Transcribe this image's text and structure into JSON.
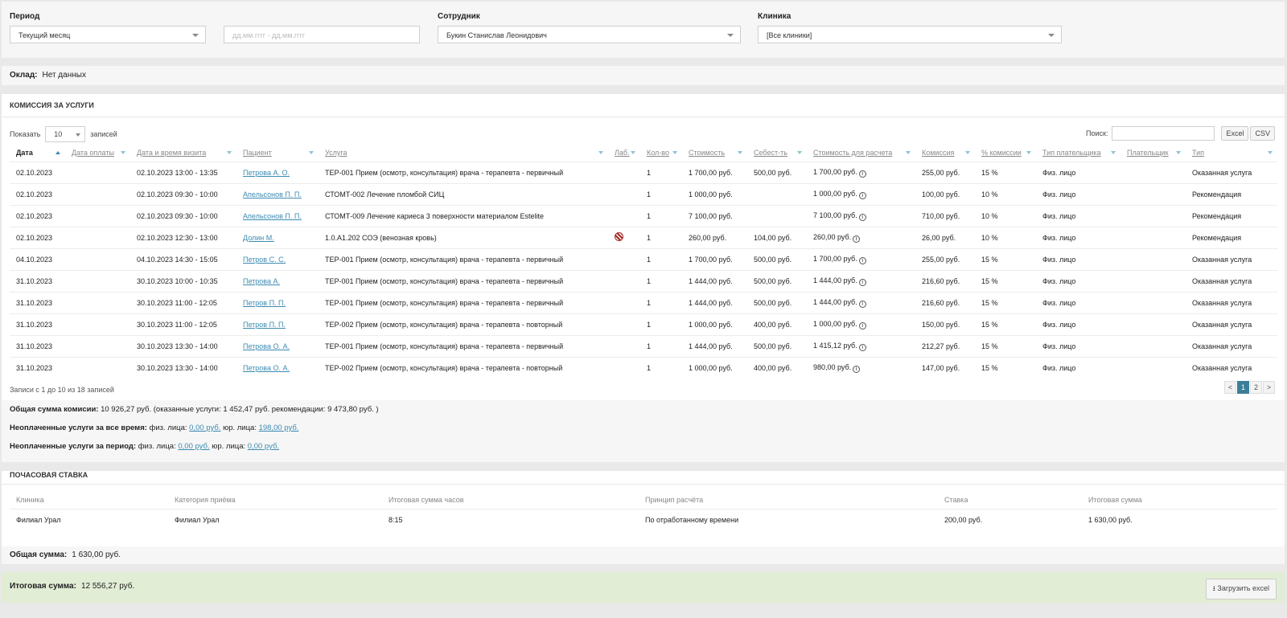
{
  "filters": {
    "period_label": "Период",
    "period_value": "Текущий месяц",
    "date_placeholder": "дд.мм.гггг - дд.мм.гггг",
    "employee_label": "Сотрудник",
    "employee_value": "Букин Станислав Леонидович",
    "clinic_label": "Клиника",
    "clinic_value": "[Все клиники]"
  },
  "oklad": {
    "label": "Оклад:",
    "value": "Нет данных"
  },
  "commission": {
    "title": "КОМИССИЯ ЗА УСЛУГИ",
    "show_label": "Показать",
    "show_value": "10",
    "records_label": "записей",
    "search_label": "Поиск:",
    "excel": "Excel",
    "csv": "CSV",
    "columns": [
      "Дата",
      "Дата оплаты",
      "Дата и время визита",
      "Пациент",
      "Услуга",
      "Лаб.",
      "Кол-во",
      "Стоимость",
      "Себест-ть",
      "Стоимость для расчета",
      "Комиссия",
      "% комиссии",
      "Тип плательщика",
      "Плательщик",
      "Тип"
    ],
    "rows": [
      {
        "date": "02.10.2023",
        "pay": "",
        "visit": "02.10.2023 13:00 - 13:35",
        "patient": "Петрова А. О.",
        "service": "ТЕР-001 Прием (осмотр, консультация) врача - терапевта - первичный",
        "lab": false,
        "qty": "1",
        "cost": "1 700,00 руб.",
        "self": "500,00 руб.",
        "calc": "1 700,00 руб.",
        "comm": "255,00 руб.",
        "pct": "15 %",
        "ptype": "Физ. лицо",
        "payer": "",
        "type": "Оказанная услуга"
      },
      {
        "date": "02.10.2023",
        "pay": "",
        "visit": "02.10.2023 09:30 - 10:00",
        "patient": "Апельсонов П. П.",
        "service": "СТОМТ-002 Лечение пломбой СИЦ",
        "lab": false,
        "qty": "1",
        "cost": "1 000,00 руб.",
        "self": "",
        "calc": "1 000,00 руб.",
        "comm": "100,00 руб.",
        "pct": "10 %",
        "ptype": "Физ. лицо",
        "payer": "",
        "type": "Рекомендация"
      },
      {
        "date": "02.10.2023",
        "pay": "",
        "visit": "02.10.2023 09:30 - 10:00",
        "patient": "Апельсонов П. П.",
        "service": "СТОМТ-009 Лечение кариеса 3 поверхности материалом Estelite",
        "lab": false,
        "qty": "1",
        "cost": "7 100,00 руб.",
        "self": "",
        "calc": "7 100,00 руб.",
        "comm": "710,00 руб.",
        "pct": "10 %",
        "ptype": "Физ. лицо",
        "payer": "",
        "type": "Рекомендация"
      },
      {
        "date": "02.10.2023",
        "pay": "",
        "visit": "02.10.2023 12:30 - 13:00",
        "patient": "Долин М.",
        "service": "1.0.А1.202 СОЭ (венозная кровь)",
        "lab": true,
        "qty": "1",
        "cost": "260,00 руб.",
        "self": "104,00 руб.",
        "calc": "260,00 руб.",
        "comm": "26,00 руб.",
        "pct": "10 %",
        "ptype": "Физ. лицо",
        "payer": "",
        "type": "Рекомендация"
      },
      {
        "date": "04.10.2023",
        "pay": "",
        "visit": "04.10.2023 14:30 - 15:05",
        "patient": "Петров С. С.",
        "service": "ТЕР-001 Прием (осмотр, консультация) врача - терапевта - первичный",
        "lab": false,
        "qty": "1",
        "cost": "1 700,00 руб.",
        "self": "500,00 руб.",
        "calc": "1 700,00 руб.",
        "comm": "255,00 руб.",
        "pct": "15 %",
        "ptype": "Физ. лицо",
        "payer": "",
        "type": "Оказанная услуга"
      },
      {
        "date": "31.10.2023",
        "pay": "",
        "visit": "30.10.2023 10:00 - 10:35",
        "patient": "Петрова А.",
        "service": "ТЕР-001 Прием (осмотр, консультация) врача - терапевта - первичный",
        "lab": false,
        "qty": "1",
        "cost": "1 444,00 руб.",
        "self": "500,00 руб.",
        "calc": "1 444,00 руб.",
        "comm": "216,60 руб.",
        "pct": "15 %",
        "ptype": "Физ. лицо",
        "payer": "",
        "type": "Оказанная услуга"
      },
      {
        "date": "31.10.2023",
        "pay": "",
        "visit": "30.10.2023 11:00 - 12:05",
        "patient": "Петров П. П.",
        "service": "ТЕР-001 Прием (осмотр, консультация) врача - терапевта - первичный",
        "lab": false,
        "qty": "1",
        "cost": "1 444,00 руб.",
        "self": "500,00 руб.",
        "calc": "1 444,00 руб.",
        "comm": "216,60 руб.",
        "pct": "15 %",
        "ptype": "Физ. лицо",
        "payer": "",
        "type": "Оказанная услуга"
      },
      {
        "date": "31.10.2023",
        "pay": "",
        "visit": "30.10.2023 11:00 - 12:05",
        "patient": "Петров П. П.",
        "service": "ТЕР-002 Прием (осмотр, консультация) врача - терапевта - повторный",
        "lab": false,
        "qty": "1",
        "cost": "1 000,00 руб.",
        "self": "400,00 руб.",
        "calc": "1 000,00 руб.",
        "comm": "150,00 руб.",
        "pct": "15 %",
        "ptype": "Физ. лицо",
        "payer": "",
        "type": "Оказанная услуга"
      },
      {
        "date": "31.10.2023",
        "pay": "",
        "visit": "30.10.2023 13:30 - 14:00",
        "patient": "Петрова О. А.",
        "service": "ТЕР-001 Прием (осмотр, консультация) врача - терапевта - первичный",
        "lab": false,
        "qty": "1",
        "cost": "1 444,00 руб.",
        "self": "500,00 руб.",
        "calc": "1 415,12 руб.",
        "comm": "212,27 руб.",
        "pct": "15 %",
        "ptype": "Физ. лицо",
        "payer": "",
        "type": "Оказанная услуга"
      },
      {
        "date": "31.10.2023",
        "pay": "",
        "visit": "30.10.2023 13:30 - 14:00",
        "patient": "Петрова О. А.",
        "service": "ТЕР-002 Прием (осмотр, консультация) врача - терапевта - повторный",
        "lab": false,
        "qty": "1",
        "cost": "1 000,00 руб.",
        "self": "400,00 руб.",
        "calc": "980,00 руб.",
        "comm": "147,00 руб.",
        "pct": "15 %",
        "ptype": "Физ. лицо",
        "payer": "",
        "type": "Оказанная услуга"
      }
    ],
    "info_glyph": "i",
    "records_info": "Записи с 1 до 10 из 18 записей",
    "pager": [
      "<",
      "1",
      "2",
      ">"
    ],
    "total_label": "Общая сумма комисии:",
    "total_value": "10 926,27 руб. (оказанные услуги: 1 452,47 руб. рекомендации: 9 473,80 руб. )",
    "unpaid_all_label": "Неоплаченные услуги за все время:",
    "unpaid_period_label": "Неоплаченные услуги за период:",
    "phys_label": "физ. лица:",
    "jur_label": "юр. лица:",
    "unpaid_all_phys": "0,00 руб.",
    "unpaid_all_jur": "198,00 руб.",
    "unpaid_period_phys": "0,00 руб.",
    "unpaid_period_jur": "0,00 руб."
  },
  "hourly": {
    "title": "ПОЧАСОВАЯ СТАВКА",
    "columns": [
      "Клиника",
      "Категория приёма",
      "Итоговая сумма часов",
      "Принцип расчёта",
      "Ставка",
      "Итоговая сумма"
    ],
    "row": [
      "Филиал Урал",
      "Филиал Урал",
      "8:15",
      "По отработанному времени",
      "200,00 руб.",
      "1 630,00 руб."
    ],
    "total_label": "Общая сумма:",
    "total_value": "1 630,00 руб."
  },
  "final": {
    "label": "Итоговая сумма:",
    "value": "12 556,27 руб.",
    "download": "Загрузить excel",
    "download_icon": "download-icon"
  },
  "colors": {
    "accent": "#3c7f99",
    "link": "#3c8bb1",
    "final_bg": "#e2edd5"
  }
}
